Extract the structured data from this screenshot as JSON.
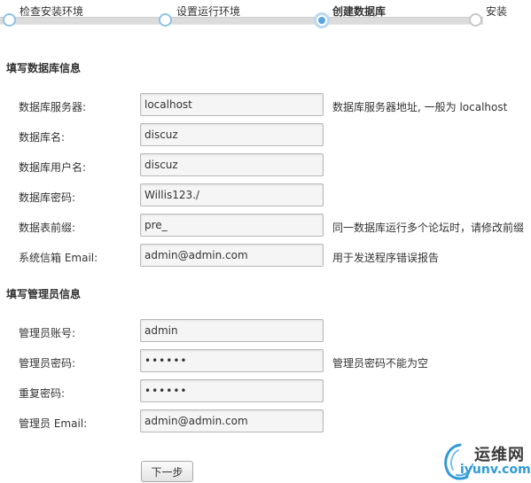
{
  "steps": [
    {
      "label": "检查安装环境",
      "state": "done"
    },
    {
      "label": "设置运行环境",
      "state": "done"
    },
    {
      "label": "创建数据库",
      "state": "current"
    },
    {
      "label": "安装",
      "state": "pending"
    }
  ],
  "db_section": {
    "title": "填写数据库信息",
    "fields": [
      {
        "label": "数据库服务器:",
        "value": "localhost",
        "hint": "数据库服务器地址, 一般为 localhost"
      },
      {
        "label": "数据库名:",
        "value": "discuz",
        "hint": ""
      },
      {
        "label": "数据库用户名:",
        "value": "discuz",
        "hint": ""
      },
      {
        "label": "数据库密码:",
        "value": "Willis123./",
        "hint": ""
      },
      {
        "label": "数据表前缀:",
        "value": "pre_",
        "hint": "同一数据库运行多个论坛时，请修改前缀"
      },
      {
        "label": "系统信箱 Email:",
        "value": "admin@admin.com",
        "hint": "用于发送程序错误报告"
      }
    ]
  },
  "admin_section": {
    "title": "填写管理员信息",
    "fields": [
      {
        "label": "管理员账号:",
        "value": "admin",
        "hint": ""
      },
      {
        "label": "管理员密码:",
        "value": "••••••",
        "hint": "管理员密码不能为空"
      },
      {
        "label": "重复密码:",
        "value": "••••••",
        "hint": ""
      },
      {
        "label": "管理员 Email:",
        "value": "admin@admin.com",
        "hint": ""
      }
    ]
  },
  "next_button": {
    "label": "下一步"
  },
  "watermark": {
    "cn": "运维网",
    "en": "iyunv.com"
  },
  "colors": {
    "accent": "#5aa6dd",
    "track": "#dcdcdc",
    "watermark_blue": "#2f9ad6"
  }
}
